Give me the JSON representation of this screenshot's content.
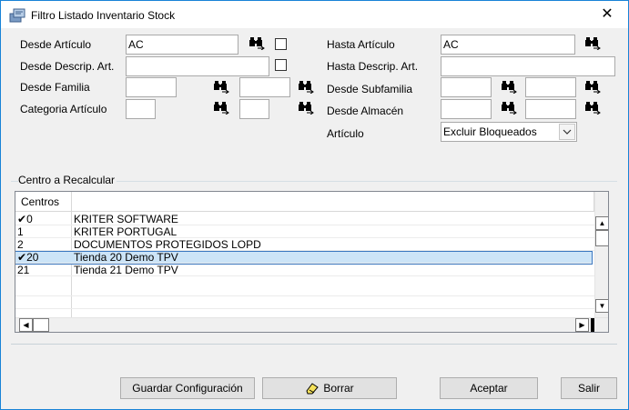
{
  "window": {
    "title": "Filtro Listado Inventario Stock",
    "close_glyph": "✕"
  },
  "filters": {
    "desde_articulo": {
      "label": "Desde Artículo",
      "value": "AC"
    },
    "hasta_articulo": {
      "label": "Hasta Artículo",
      "value": "AC"
    },
    "desde_descrip": {
      "label": "Desde Descrip. Art.",
      "value": ""
    },
    "hasta_descrip": {
      "label": "Hasta Descrip. Art.",
      "value": ""
    },
    "desde_familia": {
      "label": "Desde Familia",
      "value": "",
      "value2": ""
    },
    "desde_subfamilia": {
      "label": "Desde Subfamilia",
      "value": "",
      "value2": ""
    },
    "categoria_articulo": {
      "label": "Categoria Artículo",
      "value": "",
      "value2": ""
    },
    "desde_almacen": {
      "label": "Desde Almacén",
      "value": "",
      "value2": ""
    },
    "articulo": {
      "label": "Artículo",
      "selected": "Excluir Bloqueados"
    }
  },
  "centros": {
    "group_label": "Centro a Recalcular",
    "column_header": "Centros",
    "rows": [
      {
        "check": "✔",
        "code": "0",
        "name": "KRITER SOFTWARE"
      },
      {
        "check": "",
        "code": "1",
        "name": "KRITER PORTUGAL"
      },
      {
        "check": "",
        "code": "2",
        "name": "DOCUMENTOS PROTEGIDOS LOPD"
      },
      {
        "check": "✔",
        "code": "20",
        "name": "Tienda 20 Demo TPV"
      },
      {
        "check": "",
        "code": "21",
        "name": "Tienda 21 Demo TPV"
      }
    ]
  },
  "buttons": {
    "guardar": "Guardar Configuración",
    "borrar": "Borrar",
    "aceptar": "Aceptar",
    "salir": "Salir"
  },
  "icons": {
    "search": "binoculars-icon",
    "eraser": "eraser-icon",
    "app": "app-icon"
  }
}
